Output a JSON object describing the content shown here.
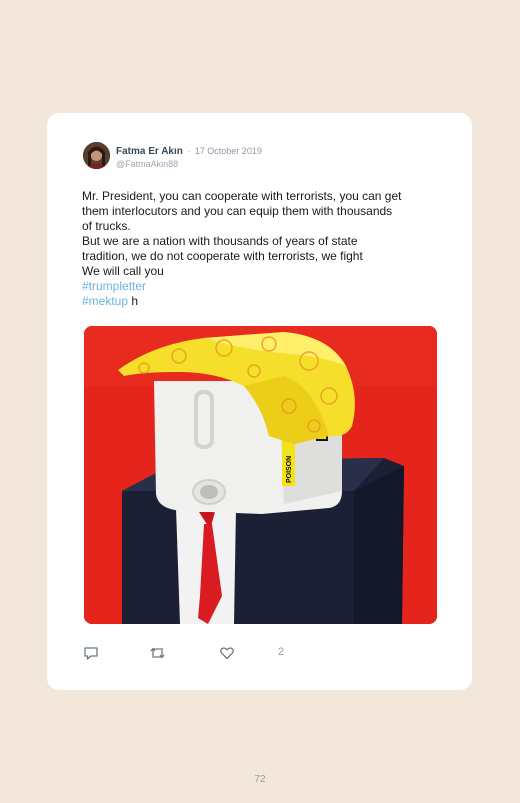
{
  "tweet": {
    "author_name": "Fatma Er Akın",
    "separator": "·",
    "date": "17 October 2019",
    "handle": "@FatmaAkin88",
    "lines": [
      "Mr. President, you can cooperate with terrorists, you can get",
      "them interlocutors and you can equip them with thousands",
      "of trucks.",
      "But we are a nation with thousands of years of state",
      "tradition, we do not cooperate with terrorists, we fight",
      "We will call you"
    ],
    "hashtag1": "#trumpletter",
    "hashtag2": "#mektup",
    "trailing_text": " h",
    "like_count": "2"
  },
  "photo": {
    "label_text": "POISON"
  },
  "icons": {
    "reply": "reply-icon",
    "retweet": "retweet-icon",
    "like": "heart-icon"
  },
  "page": {
    "number": "72"
  }
}
